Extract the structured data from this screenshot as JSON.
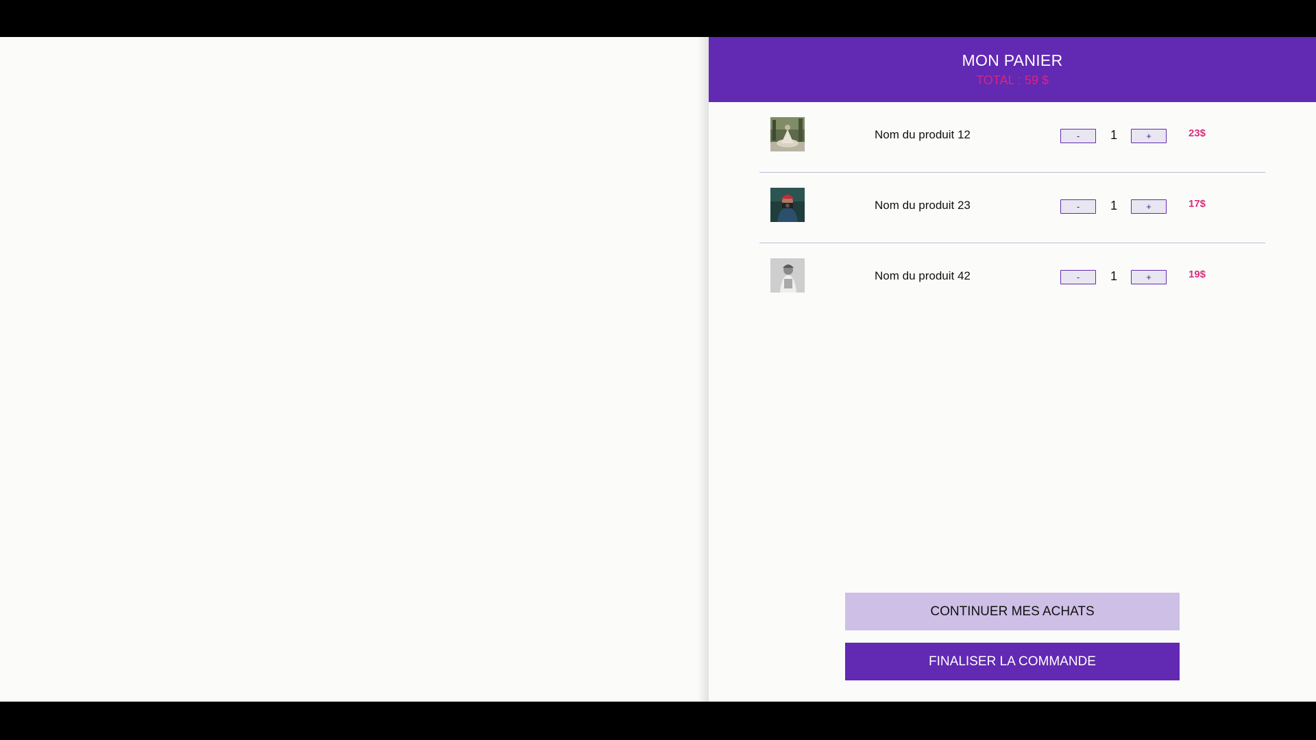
{
  "cart": {
    "title": "MON PANIER",
    "total": "TOTAL : 59 $",
    "items": [
      {
        "name": "Nom du produit 12",
        "quantity": "1",
        "price": "23$",
        "minus_label": "-",
        "plus_label": "+",
        "image": "product-image-forest-meditation"
      },
      {
        "name": "Nom du produit 23",
        "quantity": "1",
        "price": "17$",
        "minus_label": "-",
        "plus_label": "+",
        "image": "product-image-photographer"
      },
      {
        "name": "Nom du produit 42",
        "quantity": "1",
        "price": "19$",
        "minus_label": "-",
        "plus_label": "+",
        "image": "product-image-grayscale-portrait"
      }
    ]
  },
  "actions": {
    "continue_label": "CONTINUER MES ACHATS",
    "checkout_label": "FINALISER LA COMMANDE"
  },
  "colors": {
    "header_bg": "#6229b3",
    "total_text": "#e0217d",
    "price_text": "#d8307e",
    "continue_bg": "#cdbfe6",
    "checkout_bg": "#6229b3"
  }
}
